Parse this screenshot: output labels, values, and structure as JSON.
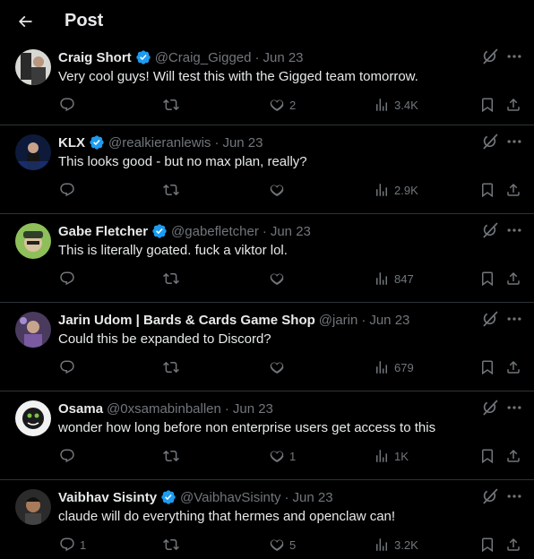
{
  "header": {
    "title": "Post"
  },
  "colors": {
    "background": "#000000",
    "text": "#e7e9ea",
    "muted": "#71767b",
    "verified": "#1d9bf0",
    "border": "#2f3336"
  },
  "tweets": [
    {
      "name": "Craig Short",
      "handle": "@Craig_Gigged",
      "date": "Jun 23",
      "text": "Very cool guys! Will test this with the Gigged team tomorrow.",
      "replies": "",
      "retweets": "",
      "likes": "2",
      "views": "3.4K"
    },
    {
      "name": "KLX",
      "handle": "@realkieranlewis",
      "date": "Jun 23",
      "text": "This looks good - but no max plan, really?",
      "replies": "",
      "retweets": "",
      "likes": "",
      "views": "2.9K"
    },
    {
      "name": "Gabe Fletcher",
      "handle": "@gabefletcher",
      "date": "Jun 23",
      "text": "This is literally goated. fuck a viktor lol.",
      "replies": "",
      "retweets": "",
      "likes": "",
      "views": "847"
    },
    {
      "name": "Jarin Udom | Bards & Cards Game Shop",
      "handle": "@jarin",
      "date": "Jun 23",
      "text": "Could this be expanded to Discord?",
      "replies": "",
      "retweets": "",
      "likes": "",
      "views": "679"
    },
    {
      "name": "Osama",
      "handle": "@0xsamabinballen",
      "date": "Jun 23",
      "text": "wonder how long before non enterprise users get access to this",
      "replies": "",
      "retweets": "",
      "likes": "1",
      "views": "1K"
    },
    {
      "name": "Vaibhav Sisinty",
      "handle": "@VaibhavSisinty",
      "date": "Jun 23",
      "text": "claude will do everything that hermes and openclaw can!",
      "replies": "1",
      "retweets": "",
      "likes": "5",
      "views": "3.2K"
    }
  ],
  "separator": "·"
}
